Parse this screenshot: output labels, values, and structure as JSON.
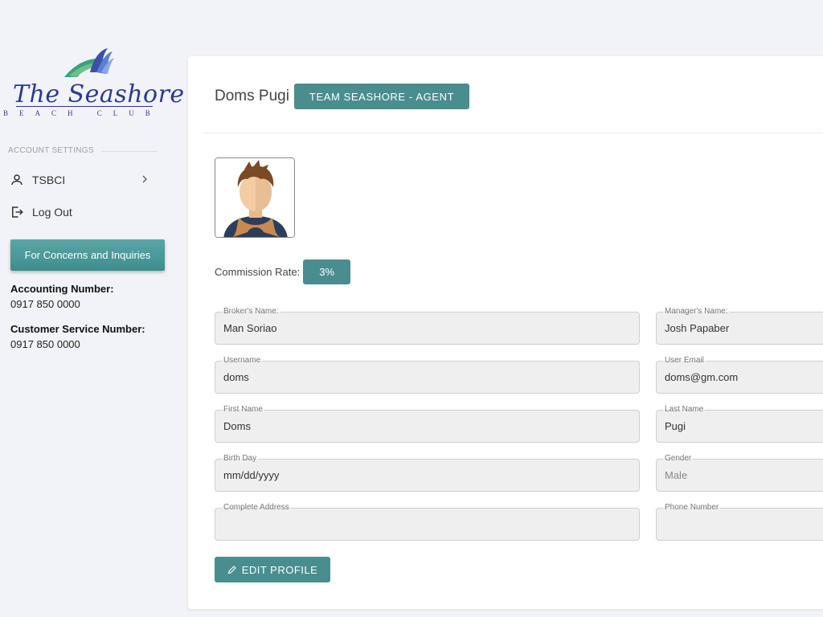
{
  "brand": {
    "title": "The Seashore",
    "subtitle": "BEACH CLUB"
  },
  "sidebar": {
    "section_label": "ACCOUNT SETTINGS",
    "items": [
      {
        "label": "TSBCI",
        "icon": "person-icon"
      },
      {
        "label": "Log Out",
        "icon": "logout-icon"
      }
    ],
    "concern_button": "For Concerns and Inquiries",
    "accounting_label": "Accounting Number:",
    "accounting_number": "0917 850 0000",
    "service_label": "Customer Service Number:",
    "service_number": "0917 850 0000"
  },
  "profile": {
    "name": "Doms Pugi",
    "team": "TEAM SEASHORE - AGENT",
    "commission_label": "Commission Rate:",
    "commission_value": "3%",
    "edit_button": "EDIT PROFILE"
  },
  "fields": {
    "broker": {
      "label": "Broker's Name:",
      "value": "Man Soriao"
    },
    "manager": {
      "label": "Manager's Name:",
      "value": "Josh Papaber"
    },
    "username": {
      "label": "Username",
      "value": "doms"
    },
    "email": {
      "label": "User Email",
      "value": "doms@gm.com"
    },
    "first_name": {
      "label": "First Name",
      "value": "Doms"
    },
    "last_name": {
      "label": "Last Name",
      "value": "Pugi"
    },
    "birthday": {
      "label": "Birth Day",
      "value": "mm/dd/yyyy"
    },
    "gender": {
      "label": "Gender",
      "value": "Male"
    },
    "address": {
      "label": "Complete Address",
      "value": ""
    },
    "phone": {
      "label": "Phone Number",
      "value": ""
    }
  },
  "colors": {
    "accent": "#4a8d8f",
    "brand": "#2b3a8f",
    "background": "#f2f3f8"
  }
}
